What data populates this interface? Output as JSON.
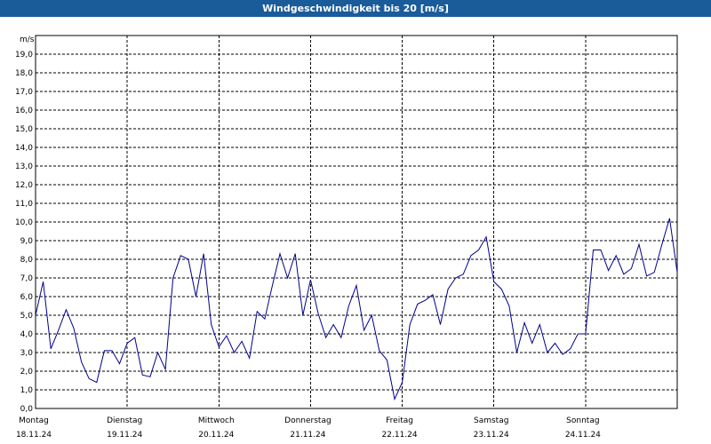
{
  "title": "Windgeschwindigkeit bis 20 [m/s]",
  "chart_data": {
    "type": "line",
    "title": "Windgeschwindigkeit bis 20 [m/s]",
    "ylabel": "m/s",
    "xlabel": "",
    "ylim": [
      0,
      20
    ],
    "xlim": [
      "2024-11-18T00:00",
      "2024-11-25T00:00"
    ],
    "y_ticks": [
      "0,0",
      "1,0",
      "2,0",
      "3,0",
      "4,0",
      "5,0",
      "6,0",
      "7,0",
      "8,0",
      "9,0",
      "10,0",
      "11,0",
      "12,0",
      "13,0",
      "14,0",
      "15,0",
      "16,0",
      "17,0",
      "18,0",
      "19,0"
    ],
    "x_ticks": [
      {
        "day": "Montag",
        "date": "18.11.24"
      },
      {
        "day": "Dienstag",
        "date": "19.11.24"
      },
      {
        "day": "Mittwoch",
        "date": "20.11.24"
      },
      {
        "day": "Donnerstag",
        "date": "21.11.24"
      },
      {
        "day": "Freitag",
        "date": "22.11.24"
      },
      {
        "day": "Samstag",
        "date": "23.11.24"
      },
      {
        "day": "Sonntag",
        "date": "24.11.24"
      }
    ],
    "grid": true,
    "series_color": "#00008b",
    "x": [
      "2024-11-18T00:00",
      "2024-11-18T02:00",
      "2024-11-18T04:00",
      "2024-11-18T06:00",
      "2024-11-18T08:00",
      "2024-11-18T10:00",
      "2024-11-18T12:00",
      "2024-11-18T14:00",
      "2024-11-18T16:00",
      "2024-11-18T18:00",
      "2024-11-18T20:00",
      "2024-11-18T22:00",
      "2024-11-19T00:00",
      "2024-11-19T02:00",
      "2024-11-19T04:00",
      "2024-11-19T06:00",
      "2024-11-19T08:00",
      "2024-11-19T10:00",
      "2024-11-19T12:00",
      "2024-11-19T14:00",
      "2024-11-19T16:00",
      "2024-11-19T18:00",
      "2024-11-19T20:00",
      "2024-11-19T22:00",
      "2024-11-20T00:00",
      "2024-11-20T02:00",
      "2024-11-20T04:00",
      "2024-11-20T06:00",
      "2024-11-20T08:00",
      "2024-11-20T10:00",
      "2024-11-20T12:00",
      "2024-11-20T14:00",
      "2024-11-20T16:00",
      "2024-11-20T18:00",
      "2024-11-20T20:00",
      "2024-11-20T22:00",
      "2024-11-21T00:00",
      "2024-11-21T02:00",
      "2024-11-21T04:00",
      "2024-11-21T06:00",
      "2024-11-21T08:00",
      "2024-11-21T10:00",
      "2024-11-21T12:00",
      "2024-11-21T14:00",
      "2024-11-21T16:00",
      "2024-11-21T18:00",
      "2024-11-21T20:00",
      "2024-11-21T22:00",
      "2024-11-22T00:00",
      "2024-11-22T02:00",
      "2024-11-22T04:00",
      "2024-11-22T06:00",
      "2024-11-22T08:00",
      "2024-11-22T10:00",
      "2024-11-22T12:00",
      "2024-11-22T14:00",
      "2024-11-22T16:00",
      "2024-11-22T18:00",
      "2024-11-22T20:00",
      "2024-11-22T22:00",
      "2024-11-23T00:00",
      "2024-11-23T02:00",
      "2024-11-23T04:00",
      "2024-11-23T06:00",
      "2024-11-23T08:00",
      "2024-11-23T10:00",
      "2024-11-23T12:00",
      "2024-11-23T14:00",
      "2024-11-23T16:00",
      "2024-11-23T18:00",
      "2024-11-23T20:00",
      "2024-11-23T22:00",
      "2024-11-24T00:00",
      "2024-11-24T02:00",
      "2024-11-24T04:00",
      "2024-11-24T06:00",
      "2024-11-24T08:00",
      "2024-11-24T10:00",
      "2024-11-24T12:00",
      "2024-11-24T14:00",
      "2024-11-24T16:00",
      "2024-11-24T18:00",
      "2024-11-24T20:00",
      "2024-11-24T22:00",
      "2024-11-25T00:00"
    ],
    "series": [
      {
        "values": [
          5.0,
          6.8,
          3.2,
          4.2,
          5.3,
          4.3,
          2.5,
          1.6,
          1.4,
          3.1,
          3.1,
          2.4,
          3.5,
          3.8,
          1.8,
          1.7,
          3.0,
          2.1,
          7.0,
          8.2,
          8.0,
          6.0,
          8.3,
          4.5,
          3.3,
          3.9,
          3.0,
          3.6,
          2.7,
          5.2,
          4.8,
          6.6,
          8.3,
          7.0,
          8.3,
          5.0,
          6.9,
          5.1,
          3.8,
          4.5,
          3.8,
          5.5,
          6.6,
          4.2,
          5.0,
          3.1,
          2.6,
          0.5,
          1.4,
          4.5,
          5.6,
          5.8,
          6.1,
          4.5,
          6.4,
          7.0,
          7.2,
          8.2,
          8.5,
          9.2,
          6.8,
          6.4,
          5.5,
          3.0,
          4.6,
          3.5,
          4.5,
          3.0,
          3.5,
          2.9,
          3.2,
          4.0,
          4.0,
          8.5,
          8.5,
          7.4,
          8.2,
          7.2,
          7.5,
          8.8,
          7.1,
          7.3,
          8.8,
          10.2,
          7.3
        ]
      }
    ]
  }
}
